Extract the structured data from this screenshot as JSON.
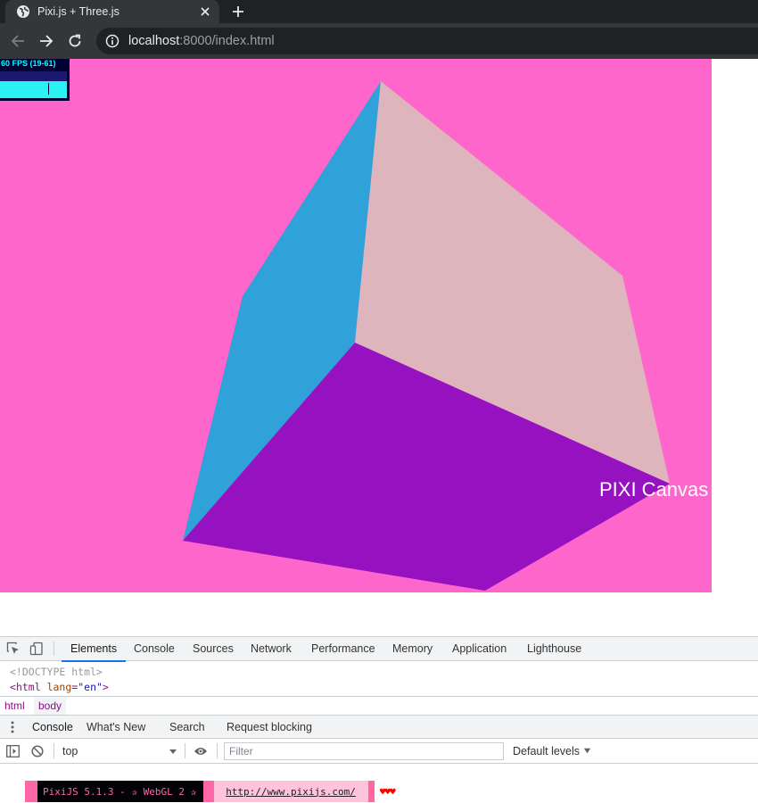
{
  "browser": {
    "tab_title": "Pixi.js + Three.js",
    "url_host": "localhost",
    "url_rest": ":8000/index.html"
  },
  "stats": {
    "fps_text": "60 FPS (19-61)"
  },
  "canvas": {
    "label": "PIXI Canvas",
    "background": "#ff66cc",
    "cube_colors": {
      "left_face": "#2ea2d9",
      "top_face": "#dfb5bd",
      "front_face": "#9612c0"
    }
  },
  "devtools": {
    "tabs": [
      "Elements",
      "Console",
      "Sources",
      "Network",
      "Performance",
      "Memory",
      "Application",
      "Lighthouse"
    ],
    "active_tab": "Elements",
    "dom": {
      "doctype": "<!DOCTYPE html>",
      "html_open": "<",
      "html_tag": "html",
      "attr_name": "lang",
      "attr_eq": "=",
      "attr_value": "\"en\"",
      "html_close": ">"
    },
    "breadcrumbs": [
      "html",
      "body"
    ],
    "drawer_tabs": [
      "Console",
      "What's New",
      "Search",
      "Request blocking"
    ],
    "drawer_active": "Console",
    "console_toolbar": {
      "context": "top",
      "filter_placeholder": "Filter",
      "levels": "Default levels"
    },
    "console_banner": {
      "text": "PixiJS 5.1.3 - ✰ WebGL 2 ✰",
      "link": "http://www.pixijs.com/",
      "hearts": "♥♥♥"
    }
  }
}
